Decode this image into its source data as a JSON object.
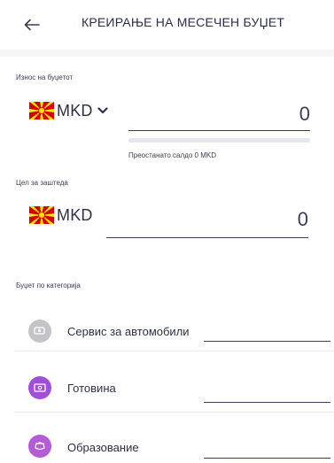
{
  "header": {
    "title": "КРЕИРАЊЕ НА МЕСЕЧЕН БУЏЕТ"
  },
  "budget_amount": {
    "label": "Износ на буџетот",
    "currency": "MKD",
    "value": "0",
    "remaining_progress_percent": 0,
    "remaining_text": "Преостанато салдо 0 MKD"
  },
  "savings_goal": {
    "label": "Цел за заштеда",
    "currency": "MKD",
    "value": "0"
  },
  "categories_section": {
    "label": "Буџет по категорија",
    "items": [
      {
        "label": "Сервис за автомобили",
        "icon": "car-service-icon",
        "color": "#c4c4c8"
      },
      {
        "label": "Готовина",
        "icon": "cash-icon",
        "color": "#a04fd8"
      },
      {
        "label": "Образование",
        "icon": "education-icon",
        "color": "#b45bd6"
      }
    ]
  },
  "colors": {
    "accent_purple": "#a04fd8",
    "text_dark": "#2d2f45",
    "flag_red": "#d20000",
    "flag_yellow": "#ffe600"
  }
}
